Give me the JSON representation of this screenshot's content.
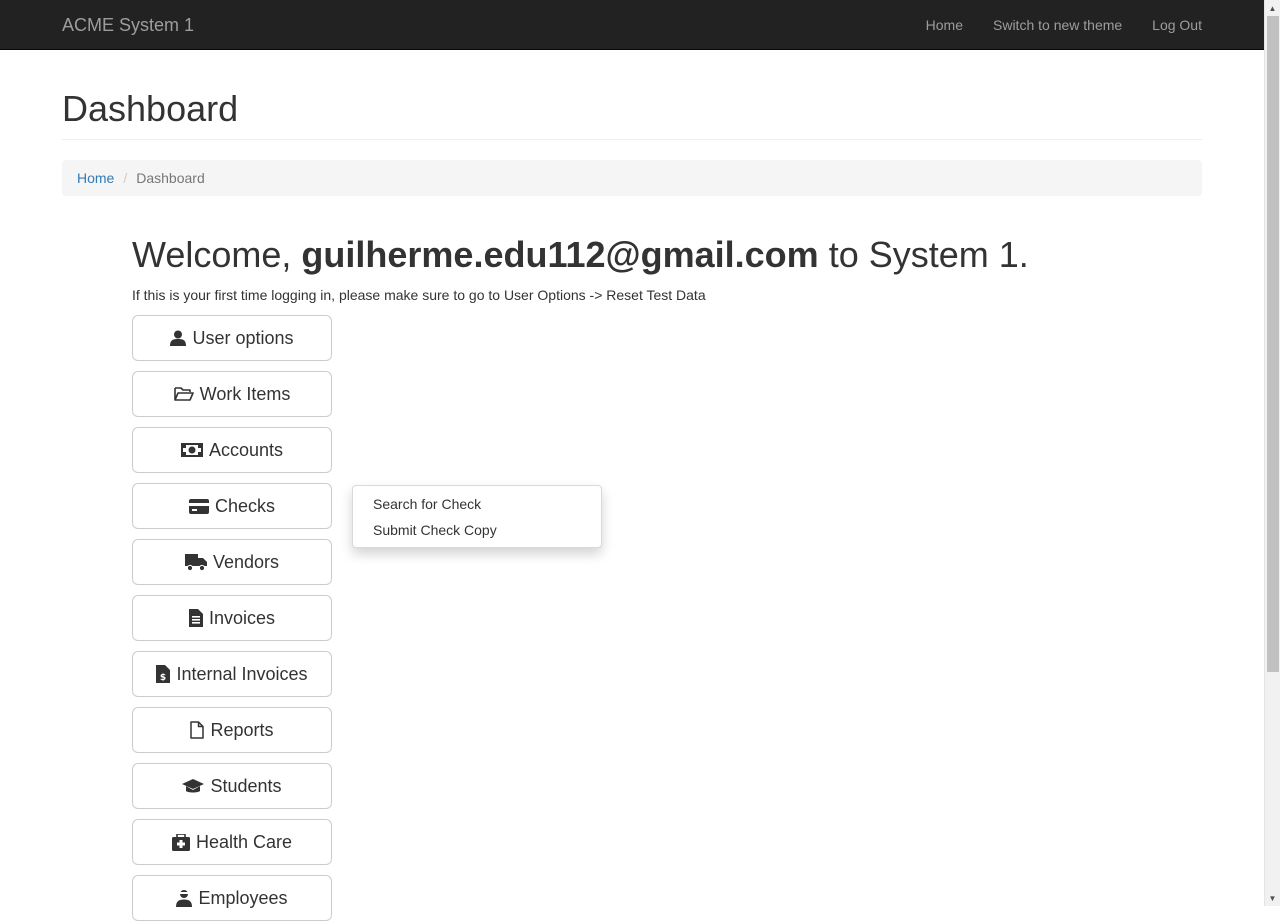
{
  "navbar": {
    "brand": "ACME System 1",
    "links": [
      "Home",
      "Switch to new theme",
      "Log Out"
    ]
  },
  "header": {
    "title": "Dashboard"
  },
  "breadcrumb": {
    "home": "Home",
    "separator": "/",
    "current": "Dashboard"
  },
  "welcome": {
    "prefix": "Welcome,",
    "user": "guilherme.edu112@gmail.com",
    "suffix": "to System 1.",
    "note": "If this is your first time logging in, please make sure to go to User Options -> Reset Test Data"
  },
  "menu": {
    "items": [
      {
        "label": "User options",
        "icon": "user-icon"
      },
      {
        "label": "Work Items",
        "icon": "folder-open-icon"
      },
      {
        "label": "Accounts",
        "icon": "money-icon"
      },
      {
        "label": "Checks",
        "icon": "credit-card-icon"
      },
      {
        "label": "Vendors",
        "icon": "truck-icon"
      },
      {
        "label": "Invoices",
        "icon": "file-text-icon"
      },
      {
        "label": "Internal Invoices",
        "icon": "file-invoice-dollar-icon"
      },
      {
        "label": "Reports",
        "icon": "file-icon"
      },
      {
        "label": "Students",
        "icon": "graduation-cap-icon"
      },
      {
        "label": "Health Care",
        "icon": "medkit-icon"
      },
      {
        "label": "Employees",
        "icon": "user-tie-icon"
      }
    ]
  },
  "dropdown": {
    "items": [
      "Search for Check",
      "Submit Check Copy"
    ]
  }
}
